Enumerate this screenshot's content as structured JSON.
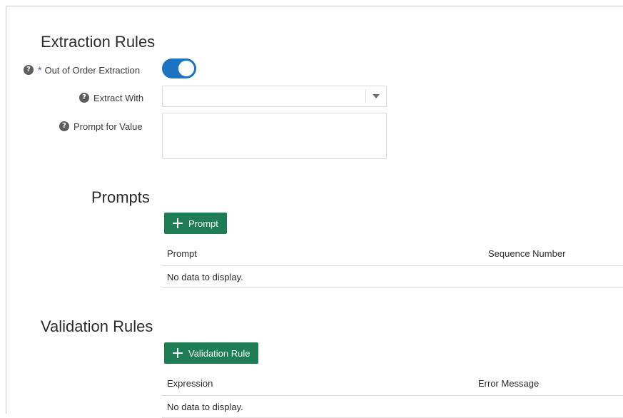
{
  "extraction": {
    "title": "Extraction Rules",
    "out_of_order_label": "Out of Order Extraction",
    "required_mark": "*",
    "toggle_on": true,
    "extract_with_label": "Extract With",
    "extract_with_value": "",
    "prompt_for_value_label": "Prompt for Value",
    "prompt_for_value_value": ""
  },
  "prompts": {
    "title": "Prompts",
    "add_button_label": "Prompt",
    "columns": [
      "Prompt",
      "Sequence Number"
    ],
    "empty_text": "No data to display."
  },
  "validation": {
    "title": "Validation Rules",
    "add_button_label": "Validation Rule",
    "columns": [
      "Expression",
      "Error Message"
    ],
    "empty_text": "No data to display."
  },
  "icons": {
    "help": "?"
  },
  "colors": {
    "accent_blue": "#1c73c2",
    "button_green": "#1e7d54"
  }
}
